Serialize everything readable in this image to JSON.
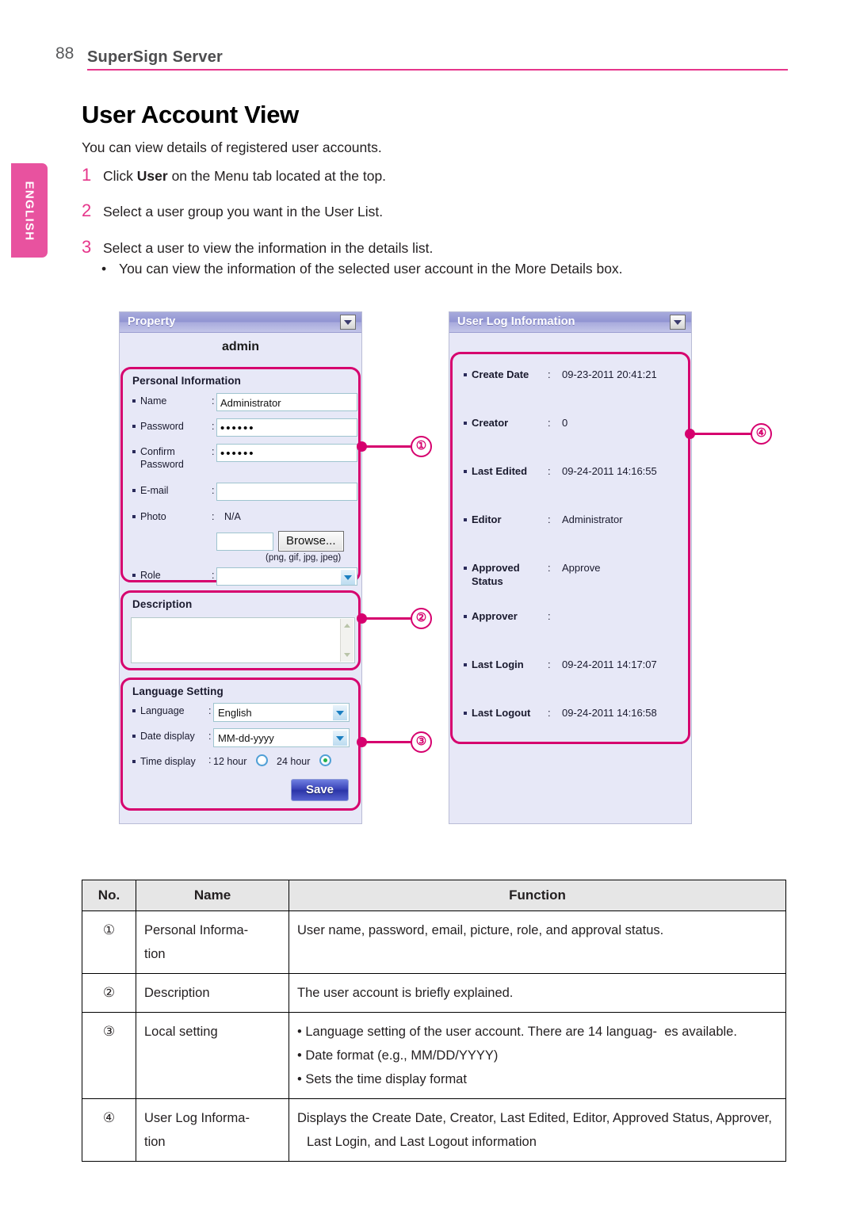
{
  "header": {
    "page_number": "88",
    "title": "SuperSign Server",
    "lang_tab": "ENGLISH"
  },
  "content": {
    "heading": "User Account View",
    "lead": "You can view details of registered user accounts.",
    "steps": [
      {
        "num": "1",
        "pre": "Click ",
        "bold": "User",
        "post": " on the Menu tab located at the top."
      },
      {
        "num": "2",
        "pre": "Select a user group you want in the User List.",
        "bold": "",
        "post": ""
      },
      {
        "num": "3",
        "pre": "Select a user to view the information in the details list.",
        "bold": "",
        "post": ""
      }
    ],
    "bullet": "You can view the information of the selected user account in the More Details box."
  },
  "property_panel": {
    "header_title": "Property",
    "collapse_icon": "chevron-down-icon",
    "account_name": "admin",
    "personal_information": {
      "section_title": "Personal Information",
      "name_label": "Name",
      "name_value": "Administrator",
      "password_label": "Password",
      "password_value": "••••••",
      "confirm_label_line1": "Confirm",
      "confirm_label_line2": "Password",
      "confirm_value": "••••••",
      "email_label": "E-mail",
      "email_value": "",
      "photo_label": "Photo",
      "photo_value": "N/A",
      "photo_file_value": "",
      "browse_label": "Browse...",
      "formats_hint": "(png, gif, jpg, jpeg)",
      "role_label": "Role",
      "role_value": ""
    },
    "description": {
      "section_title": "Description",
      "text_value": ""
    },
    "language_setting": {
      "section_title": "Language Setting",
      "language_label": "Language",
      "language_value": "English",
      "date_display_label": "Date display",
      "date_display_value": "MM-dd-yyyy",
      "time_display_label": "Time display",
      "time_option_12": "12 hour",
      "time_option_24": "24 hour",
      "time_selected": "24 hour"
    },
    "save_label": "Save"
  },
  "log_panel": {
    "header_title": "User Log Information",
    "collapse_icon": "chevron-down-icon",
    "rows": [
      {
        "label": "Create Date",
        "label2": "",
        "value": "09-23-2011 20:41:21"
      },
      {
        "label": "Creator",
        "label2": "",
        "value": "0"
      },
      {
        "label": "Last Edited",
        "label2": "",
        "value": "09-24-2011 14:16:55"
      },
      {
        "label": "Editor",
        "label2": "",
        "value": "Administrator"
      },
      {
        "label": "Approved",
        "label2": "Status",
        "value": "Approve"
      },
      {
        "label": "Approver",
        "label2": "",
        "value": ""
      },
      {
        "label": "Last Login",
        "label2": "",
        "value": "09-24-2011 14:17:07"
      },
      {
        "label": "Last Logout",
        "label2": "",
        "value": "09-24-2011 14:16:58"
      }
    ]
  },
  "callouts": [
    {
      "marker": "①"
    },
    {
      "marker": "②"
    },
    {
      "marker": "③"
    },
    {
      "marker": "④"
    }
  ],
  "legend_table": {
    "columns": [
      "No.",
      "Name",
      "Function"
    ],
    "rows": [
      {
        "no": "①",
        "name": "Personal Informa-\ntion",
        "function_lines": [
          "User name, password, email, picture, role, and approval status."
        ]
      },
      {
        "no": "②",
        "name": "Description",
        "function_lines": [
          "The user account is briefly explained."
        ]
      },
      {
        "no": "③",
        "name": "Local setting",
        "function_lines": [
          "• Language setting of the user account. There are 14 languag-  es available.",
          "• Date format (e.g., MM/DD/YYYY)",
          "• Sets the time display format"
        ]
      },
      {
        "no": "④",
        "name": "User Log Informa-\ntion",
        "function_lines": [
          "Displays the Create Date, Creator, Last Edited, Editor, Approved Status, Approver, Last Login, and Last Logout information"
        ]
      }
    ]
  },
  "colors": {
    "accent_magenta": "#d6006e",
    "brand_pink": "#e6368b",
    "panel_header": "#9093d2",
    "panel_bg": "#e7e8f7",
    "save_blue": "#2b35a8"
  }
}
